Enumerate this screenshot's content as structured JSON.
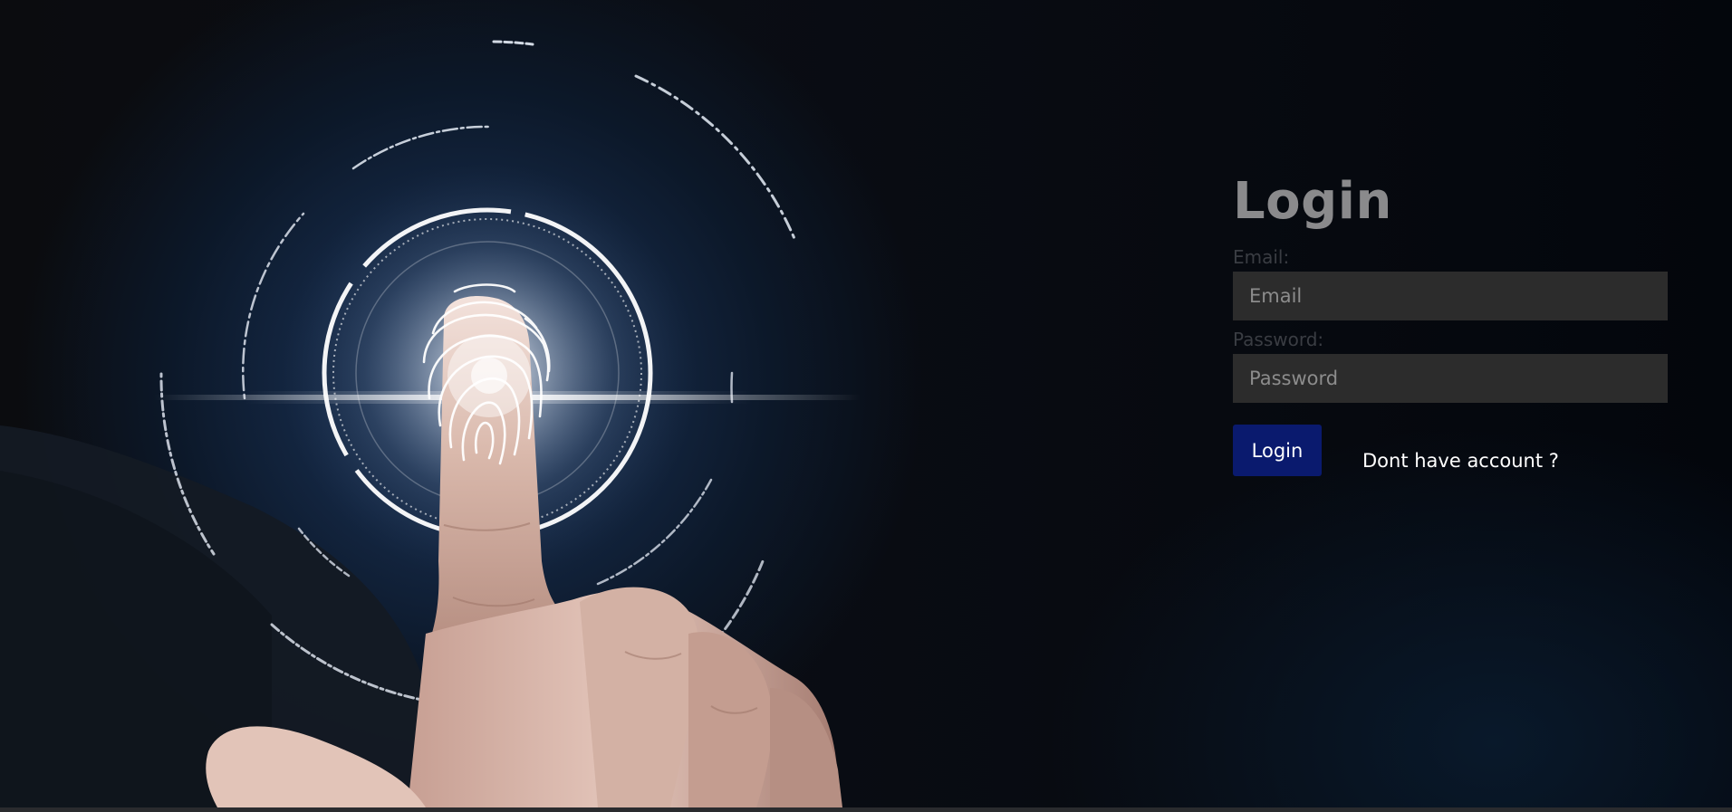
{
  "login": {
    "title": "Login",
    "email_label": "Email:",
    "email_placeholder": "Email",
    "password_label": "Password:",
    "password_placeholder": "Password",
    "submit_label": "Login",
    "signup_link": "Dont have account ?"
  },
  "hero": {
    "image": "fingerprint-scan-hand"
  },
  "colors": {
    "background": "#07090d",
    "title": "#8a8a8c",
    "input_background": "#2c2c2c",
    "button": "#0a1a6e",
    "link": "#ffffff"
  }
}
